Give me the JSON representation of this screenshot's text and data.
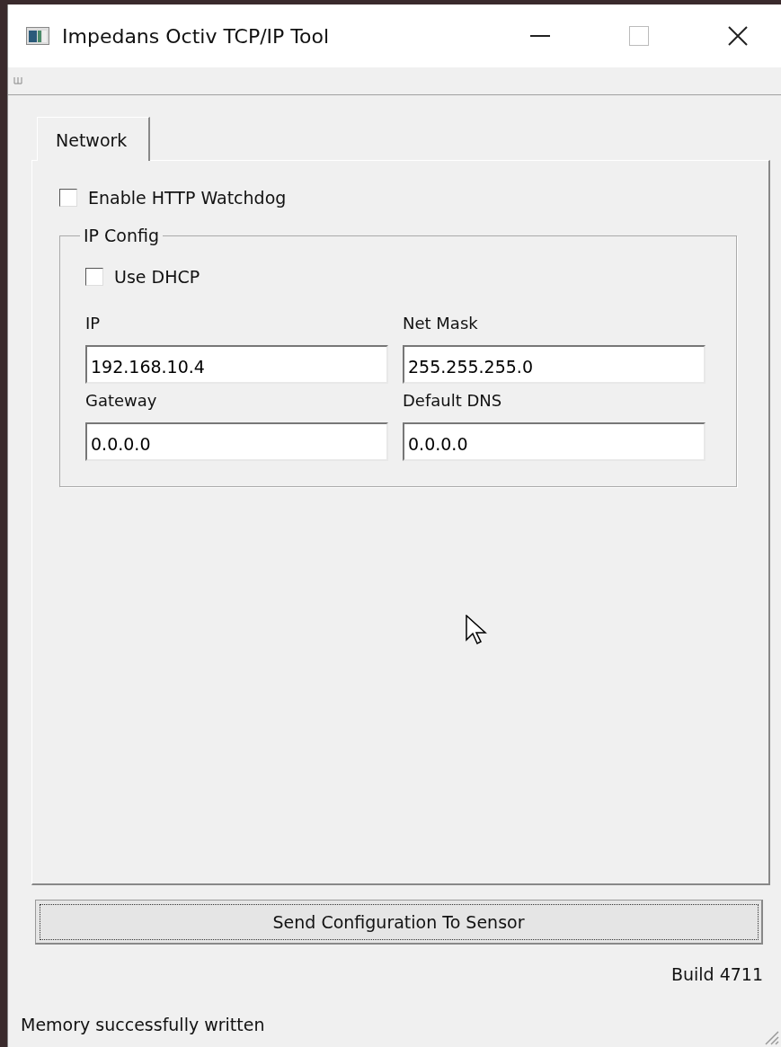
{
  "window": {
    "title": "Impedans Octiv TCP/IP Tool"
  },
  "tabs": [
    {
      "label": "Network",
      "selected": true
    }
  ],
  "watchdog": {
    "label": "Enable HTTP Watchdog",
    "checked": false
  },
  "ip_config": {
    "title": "IP Config",
    "dhcp": {
      "label": "Use DHCP",
      "checked": false
    },
    "fields": [
      {
        "label": "IP",
        "value": "192.168.10.4"
      },
      {
        "label": "Net Mask",
        "value": "255.255.255.0"
      },
      {
        "label": "Gateway",
        "value": "0.0.0.0"
      },
      {
        "label": "Default DNS",
        "value": "0.0.0.0"
      }
    ]
  },
  "send_button": "Send Configuration To Sensor",
  "build": "Build 4711",
  "status_bar": "Memory successfully written"
}
